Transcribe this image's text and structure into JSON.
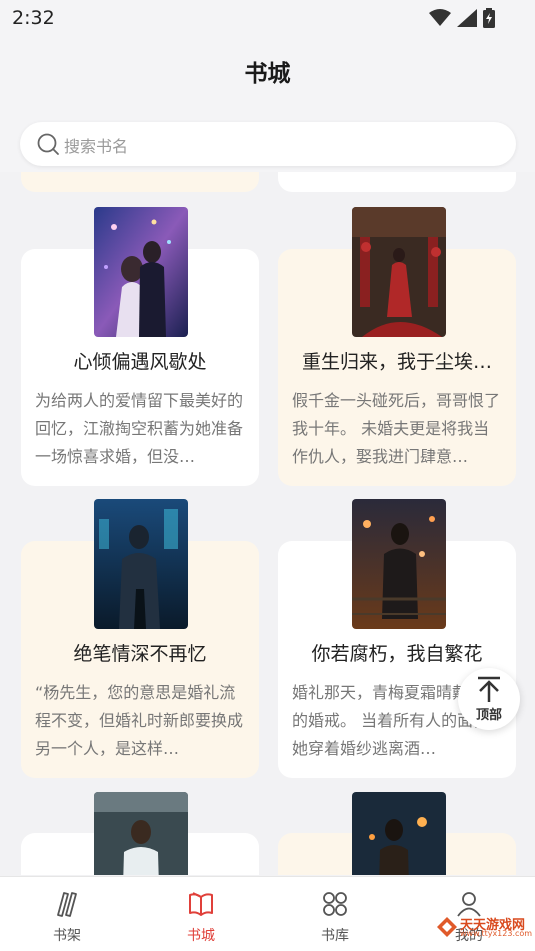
{
  "status_bar": {
    "time": "2:32"
  },
  "header": {
    "title": "书城"
  },
  "search": {
    "placeholder": "搜索书名"
  },
  "books": [
    {
      "title": "心倾偏遇风歇处",
      "description": "为给两人的爱情留下最美好的回忆，江澈掏空积蓄为她准备一场惊喜求婚，但没…"
    },
    {
      "title": "重生归来，我于尘埃…",
      "description": "假千金一头碰死后，哥哥恨了我十年。 未婚夫更是将我当作仇人，娶我进门肆意…"
    },
    {
      "title": "绝笔情深不再忆",
      "description": "“杨先生，您的意思是婚礼流程不变，但婚礼时新郎要换成另一个人，是这样…"
    },
    {
      "title": "你若腐朽，我自繁花",
      "description": "婚礼那天，青梅夏霜晴戴上我的婚戒。 当着所有人的面，她穿着婚纱逃离酒…"
    }
  ],
  "back_to_top": {
    "label": "顶部"
  },
  "bottom_nav": [
    {
      "label": "书架",
      "icon": "bookshelf-icon"
    },
    {
      "label": "书城",
      "icon": "book-open-icon",
      "active": true
    },
    {
      "label": "书库",
      "icon": "grid-icon"
    },
    {
      "label": "我的",
      "icon": "user-icon"
    }
  ],
  "watermark": {
    "text": "天天游戏网",
    "url": "www.ttyx123.com"
  },
  "colors": {
    "accent": "#e0403a",
    "cream_card": "#fdf6ea",
    "background": "#f2f2f4"
  }
}
